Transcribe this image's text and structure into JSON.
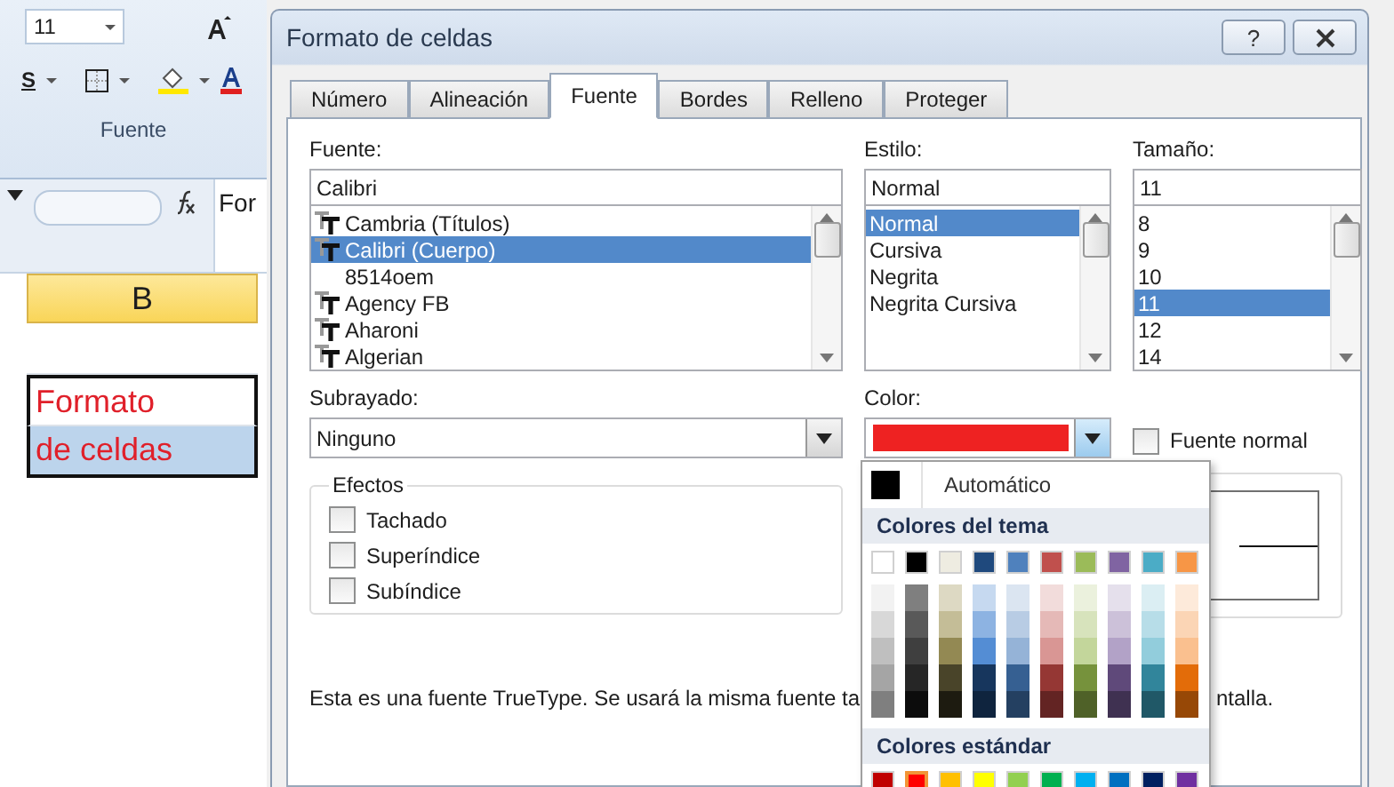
{
  "ribbon": {
    "font_size": "11",
    "group_label": "Fuente",
    "underline_button": "S"
  },
  "formula_bar": {
    "content": "For"
  },
  "sheet": {
    "column_header": "B",
    "cells": [
      {
        "text": "",
        "selected": false
      },
      {
        "text": "Formato",
        "selected": false
      },
      {
        "text": "de celdas",
        "selected": true
      }
    ]
  },
  "window": {
    "title": "Formato de celdas",
    "help": "?"
  },
  "tabs": [
    {
      "label": "Número",
      "selected": false
    },
    {
      "label": "Alineación",
      "selected": false
    },
    {
      "label": "Fuente",
      "selected": true
    },
    {
      "label": "Bordes",
      "selected": false
    },
    {
      "label": "Relleno",
      "selected": false
    },
    {
      "label": "Proteger",
      "selected": false
    }
  ],
  "font": {
    "label": "Fuente:",
    "value": "Calibri",
    "items": [
      {
        "label": "Cambria (Títulos)",
        "kind": "truetype",
        "selected": false
      },
      {
        "label": "Calibri (Cuerpo)",
        "kind": "truetype",
        "selected": true
      },
      {
        "label": "8514oem",
        "kind": "plain",
        "selected": false
      },
      {
        "label": "Agency FB",
        "kind": "truetype",
        "selected": false
      },
      {
        "label": "Aharoni",
        "kind": "truetype",
        "selected": false
      },
      {
        "label": "Algerian",
        "kind": "truetype",
        "selected": false
      }
    ]
  },
  "style": {
    "label": "Estilo:",
    "value": "Normal",
    "items": [
      {
        "label": "Normal",
        "selected": true
      },
      {
        "label": "Cursiva",
        "selected": false
      },
      {
        "label": "Negrita",
        "selected": false
      },
      {
        "label": "Negrita Cursiva",
        "selected": false
      }
    ]
  },
  "size": {
    "label": "Tamaño:",
    "value": "11",
    "items": [
      {
        "label": "8",
        "selected": false
      },
      {
        "label": "9",
        "selected": false
      },
      {
        "label": "10",
        "selected": false
      },
      {
        "label": "11",
        "selected": true
      },
      {
        "label": "12",
        "selected": false
      },
      {
        "label": "14",
        "selected": false
      }
    ]
  },
  "underline": {
    "label": "Subrayado:",
    "value": "Ninguno"
  },
  "color": {
    "label": "Color:",
    "color": "#ee2222"
  },
  "normal_font": {
    "label": "Fuente normal",
    "checked": false
  },
  "effects": {
    "title": "Efectos",
    "items": [
      {
        "label": "Tachado",
        "checked": false
      },
      {
        "label": "Superíndice",
        "checked": false
      },
      {
        "label": "Subíndice",
        "checked": false
      }
    ]
  },
  "description": {
    "start": "Esta es una fuente TrueType. Se usará la misma fuente ta",
    "end": "ntalla."
  },
  "color_menu": {
    "automatic": "Automático",
    "theme_title": "Colores del tema",
    "theme_colors": [
      {
        "color": "#ffffff"
      },
      {
        "color": "#000000"
      },
      {
        "color": "#eeece1"
      },
      {
        "color": "#1f497d"
      },
      {
        "color": "#4f81bd"
      },
      {
        "color": "#c0504d"
      },
      {
        "color": "#9bbb59"
      },
      {
        "color": "#8064a2"
      },
      {
        "color": "#4bacc6"
      },
      {
        "color": "#f79646"
      }
    ],
    "theme_shades": [
      [
        {
          "color": "#f2f2f2"
        },
        {
          "color": "#7f7f7f"
        },
        {
          "color": "#ddd9c3"
        },
        {
          "color": "#c6d9f0"
        },
        {
          "color": "#dbe5f1"
        },
        {
          "color": "#f2dcdb"
        },
        {
          "color": "#ebf1dd"
        },
        {
          "color": "#e5e0ec"
        },
        {
          "color": "#dbeef3"
        },
        {
          "color": "#fdeada"
        }
      ],
      [
        {
          "color": "#d8d8d8"
        },
        {
          "color": "#595959"
        },
        {
          "color": "#c4bd97"
        },
        {
          "color": "#8db3e2"
        },
        {
          "color": "#b8cce4"
        },
        {
          "color": "#e5b9b7"
        },
        {
          "color": "#d7e3bc"
        },
        {
          "color": "#ccc1d9"
        },
        {
          "color": "#b7dde8"
        },
        {
          "color": "#fbd5b5"
        }
      ],
      [
        {
          "color": "#bfbfbf"
        },
        {
          "color": "#3f3f3f"
        },
        {
          "color": "#938953"
        },
        {
          "color": "#548dd4"
        },
        {
          "color": "#95b3d7"
        },
        {
          "color": "#d99694"
        },
        {
          "color": "#c3d69b"
        },
        {
          "color": "#b2a2c7"
        },
        {
          "color": "#92cddc"
        },
        {
          "color": "#fac08f"
        }
      ],
      [
        {
          "color": "#a5a5a5"
        },
        {
          "color": "#262626"
        },
        {
          "color": "#494429"
        },
        {
          "color": "#17365d"
        },
        {
          "color": "#366092"
        },
        {
          "color": "#953734"
        },
        {
          "color": "#76923c"
        },
        {
          "color": "#5f497a"
        },
        {
          "color": "#31859b"
        },
        {
          "color": "#e36c09"
        }
      ],
      [
        {
          "color": "#7f7f7f"
        },
        {
          "color": "#0c0c0c"
        },
        {
          "color": "#1d1b10"
        },
        {
          "color": "#0f243e"
        },
        {
          "color": "#244061"
        },
        {
          "color": "#632423"
        },
        {
          "color": "#4f6128"
        },
        {
          "color": "#3f3151"
        },
        {
          "color": "#205867"
        },
        {
          "color": "#974806"
        }
      ]
    ],
    "standard_title": "Colores estándar",
    "standard_colors": [
      {
        "color": "#c00000",
        "selected": false
      },
      {
        "color": "#ff0000",
        "selected": true
      },
      {
        "color": "#ffc000",
        "selected": false
      },
      {
        "color": "#ffff00",
        "selected": false
      },
      {
        "color": "#92d050",
        "selected": false
      },
      {
        "color": "#00b050",
        "selected": false
      },
      {
        "color": "#00b0f0",
        "selected": false
      },
      {
        "color": "#0070c0",
        "selected": false
      },
      {
        "color": "#002060",
        "selected": false
      },
      {
        "color": "#7030a0",
        "selected": false
      }
    ]
  }
}
